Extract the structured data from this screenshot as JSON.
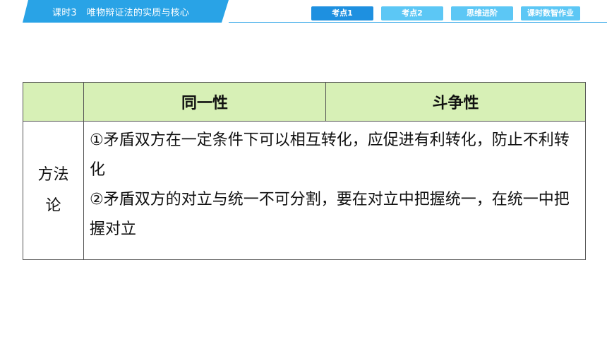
{
  "header": {
    "lesson_no": "课时3",
    "lesson_name": "唯物辩证法的实质与核心",
    "tabs": [
      {
        "label": "考点1",
        "active": true
      },
      {
        "label": "考点2",
        "active": false
      },
      {
        "label": "思维进阶",
        "active": false
      },
      {
        "label": "课时数智作业",
        "active": false
      }
    ]
  },
  "table": {
    "corner": "",
    "col_headers": [
      "同一性",
      "斗争性"
    ],
    "row_header": [
      "方法",
      "论"
    ],
    "content": [
      "①矛盾双方在一定条件下可以相互转化，应促进有利转化，防止不利转化",
      "②矛盾双方的对立与统一不可分割，要在对立中把握统一，在统一中把握对立"
    ]
  },
  "colors": {
    "accent": "#29a3e6",
    "tab": "#5cc7f5",
    "tab_active": "#1e90e0",
    "header_fill": "#d7f0b6"
  }
}
